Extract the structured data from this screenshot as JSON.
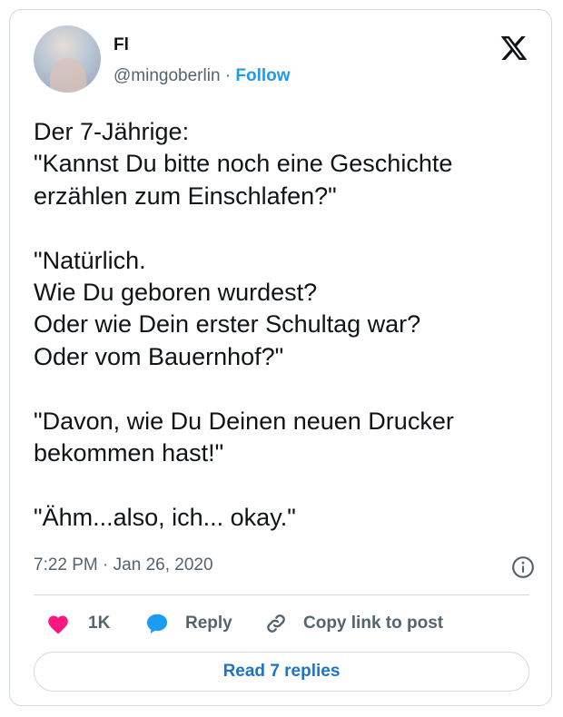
{
  "author": {
    "name": "Fl",
    "handle": "@mingoberlin",
    "separator": "·",
    "follow_label": "Follow"
  },
  "tweet": {
    "text": "Der 7-Jährige:\n\"Kannst Du bitte noch eine Geschichte\nerzählen zum Einschlafen?\"\n\n\"Natürlich.\nWie Du geboren wurdest?\nOder wie Dein erster Schultag war?\nOder vom Bauernhof?\"\n\n\"Davon, wie Du Deinen neuen Drucker\nbekommen hast!\"\n\n\"Ähm...also, ich... okay.\"",
    "time": "7:22 PM",
    "separator": "·",
    "date": "Jan 26, 2020"
  },
  "actions": {
    "like_count": "1K",
    "reply_label": "Reply",
    "copy_link_label": "Copy link to post"
  },
  "footer": {
    "read_replies_label": "Read 7 replies"
  },
  "icons": {
    "brand": "x-logo-icon",
    "info": "info-icon",
    "like": "heart-icon",
    "reply": "speech-bubble-icon",
    "copy_link": "link-icon"
  },
  "colors": {
    "accent": "#1d9bf0",
    "like": "#f91880",
    "text_primary": "#0f1419",
    "text_secondary": "#536471",
    "border": "#cfd9de"
  }
}
